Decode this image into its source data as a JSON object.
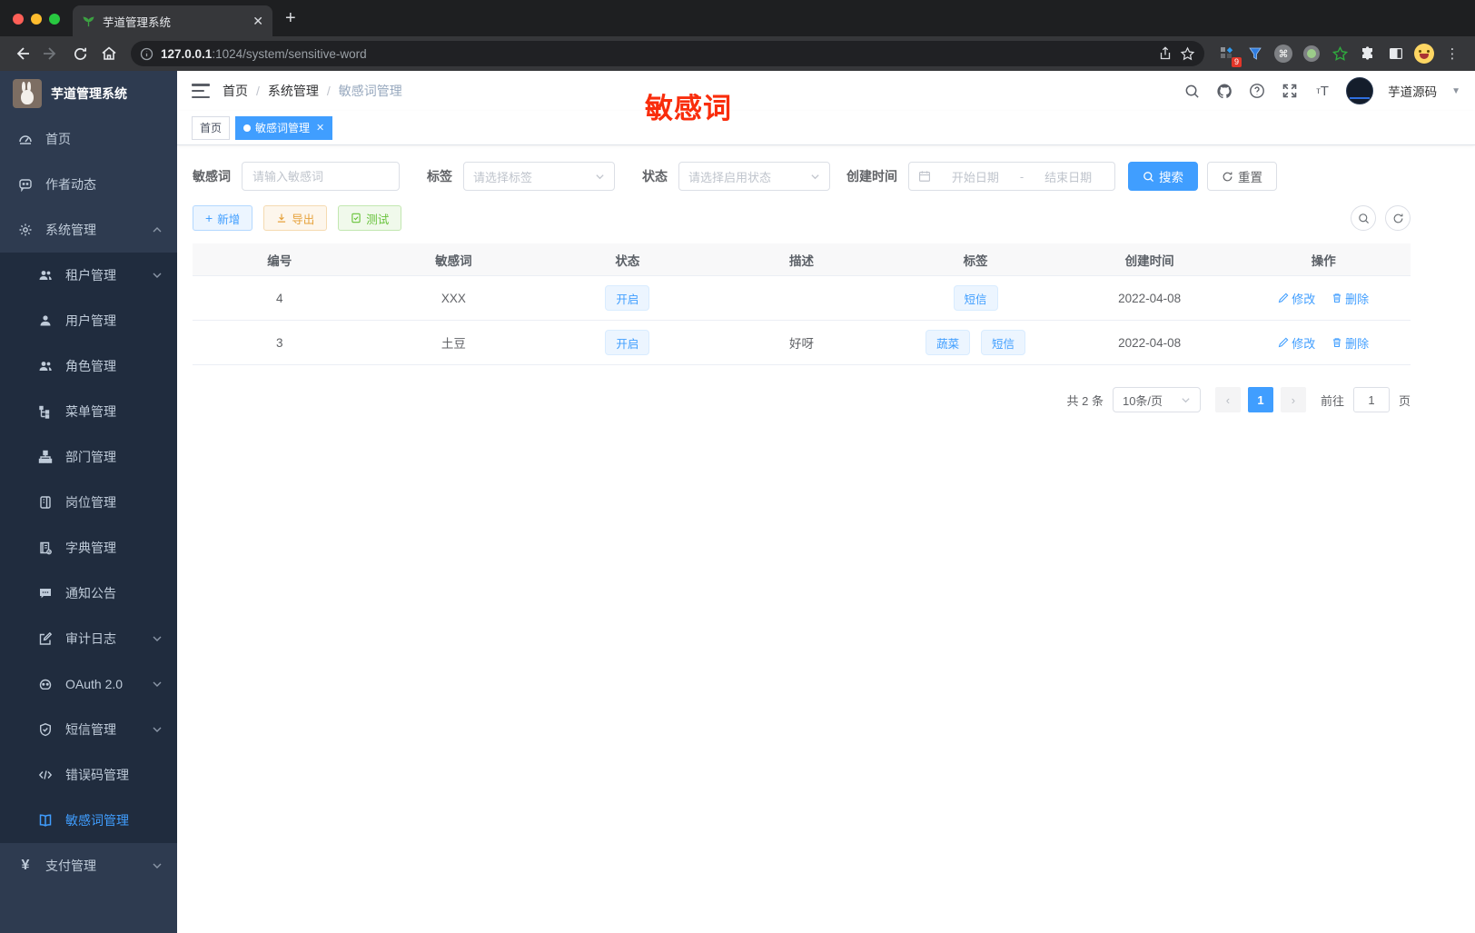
{
  "theme": {
    "primary": "#409eff",
    "success": "#67c23a",
    "warning": "#e6a23c",
    "annotation_red": "#f92d0c",
    "sidebar_bg": "#2e3b50",
    "submenu_bg": "#202c3e",
    "win_close": "#ff5f57",
    "win_min": "#febc2e",
    "win_max": "#28c840"
  },
  "browser": {
    "tab_title": "芋道管理系统",
    "url_host": "127.0.0.1",
    "url_rest": ":1024/system/sensitive-word",
    "ext_badge": "9",
    "cmd_glyph": "⌘"
  },
  "sidebar": {
    "app_title": "芋道管理系统",
    "items": [
      {
        "label": "首页",
        "level": "top"
      },
      {
        "label": "作者动态",
        "level": "top"
      },
      {
        "label": "系统管理",
        "level": "top",
        "chevron": "up"
      },
      {
        "label": "租户管理",
        "level": "sub",
        "chevron": "down"
      },
      {
        "label": "用户管理",
        "level": "sub"
      },
      {
        "label": "角色管理",
        "level": "sub"
      },
      {
        "label": "菜单管理",
        "level": "sub"
      },
      {
        "label": "部门管理",
        "level": "sub"
      },
      {
        "label": "岗位管理",
        "level": "sub"
      },
      {
        "label": "字典管理",
        "level": "sub"
      },
      {
        "label": "通知公告",
        "level": "sub"
      },
      {
        "label": "审计日志",
        "level": "sub",
        "chevron": "down"
      },
      {
        "label": "OAuth 2.0",
        "level": "sub",
        "chevron": "down"
      },
      {
        "label": "短信管理",
        "level": "sub",
        "chevron": "down"
      },
      {
        "label": "错误码管理",
        "level": "sub"
      },
      {
        "label": "敏感词管理",
        "level": "sub",
        "active": true
      },
      {
        "label": "支付管理",
        "level": "top",
        "chevron": "down"
      }
    ]
  },
  "header": {
    "breadcrumb": [
      "首页",
      "系统管理",
      "敏感词管理"
    ],
    "breadcrumb_sep": "/",
    "username": "芋道源码"
  },
  "tags": {
    "home": "首页",
    "active": "敏感词管理"
  },
  "annotation": {
    "text": "敏感词"
  },
  "filters": {
    "keyword_label": "敏感词",
    "keyword_placeholder": "请输入敏感词",
    "tag_label": "标签",
    "tag_placeholder": "请选择标签",
    "status_label": "状态",
    "status_placeholder": "请选择启用状态",
    "date_label": "创建时间",
    "date_start": "开始日期",
    "date_sep": "-",
    "date_end": "结束日期",
    "search": "搜索",
    "reset": "重置"
  },
  "actions": {
    "add": "新增",
    "export": "导出",
    "test": "测试"
  },
  "table": {
    "headers": [
      "编号",
      "敏感词",
      "状态",
      "描述",
      "标签",
      "创建时间",
      "操作"
    ],
    "rows": [
      {
        "id": "4",
        "word": "XXX",
        "status": "开启",
        "desc": "",
        "tags": [
          "短信"
        ],
        "created": "2022-04-08"
      },
      {
        "id": "3",
        "word": "土豆",
        "status": "开启",
        "desc": "好呀",
        "tags": [
          "蔬菜",
          "短信"
        ],
        "created": "2022-04-08"
      }
    ],
    "edit_label": "修改",
    "delete_label": "删除"
  },
  "pagination": {
    "total": "共 2 条",
    "page_size": "10条/页",
    "page": "1",
    "goto_label": "前往",
    "goto_value": "1",
    "unit_label": "页"
  }
}
